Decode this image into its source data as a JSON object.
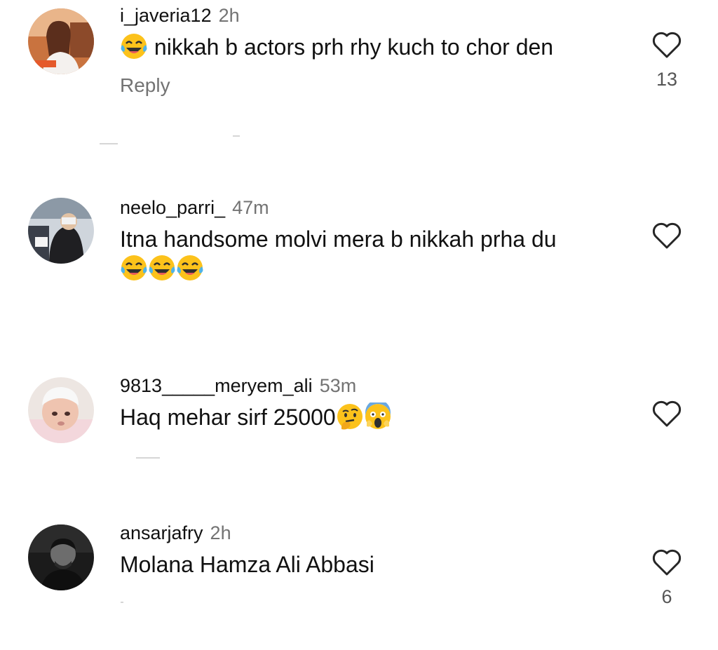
{
  "comments": [
    {
      "username": "i_javeria12",
      "time": "2h",
      "text": "nikkah b actors prh rhy kuch to chor den",
      "reply_label": "Reply",
      "like_count": "13",
      "emojis_before": [
        "tears-of-joy"
      ],
      "emojis_after": []
    },
    {
      "username": "neelo_parri_",
      "time": "47m",
      "text": "Itna handsome molvi mera b nikkah prha du",
      "emojis_after": [
        "tears-of-joy",
        "tears-of-joy",
        "tears-of-joy"
      ]
    },
    {
      "username": "9813_____meryem_ali",
      "time": "53m",
      "text": "Haq mehar sirf 25000",
      "emojis_after": [
        "thinking-face",
        "screaming-face"
      ]
    },
    {
      "username": "ansarjafry",
      "time": "2h",
      "text": "Molana Hamza Ali Abbasi",
      "like_count": "6"
    }
  ],
  "colors": {
    "text": "#111111",
    "muted": "#737373",
    "heart_outline": "#262626"
  },
  "icons": {
    "like": "heart-outline-icon"
  }
}
